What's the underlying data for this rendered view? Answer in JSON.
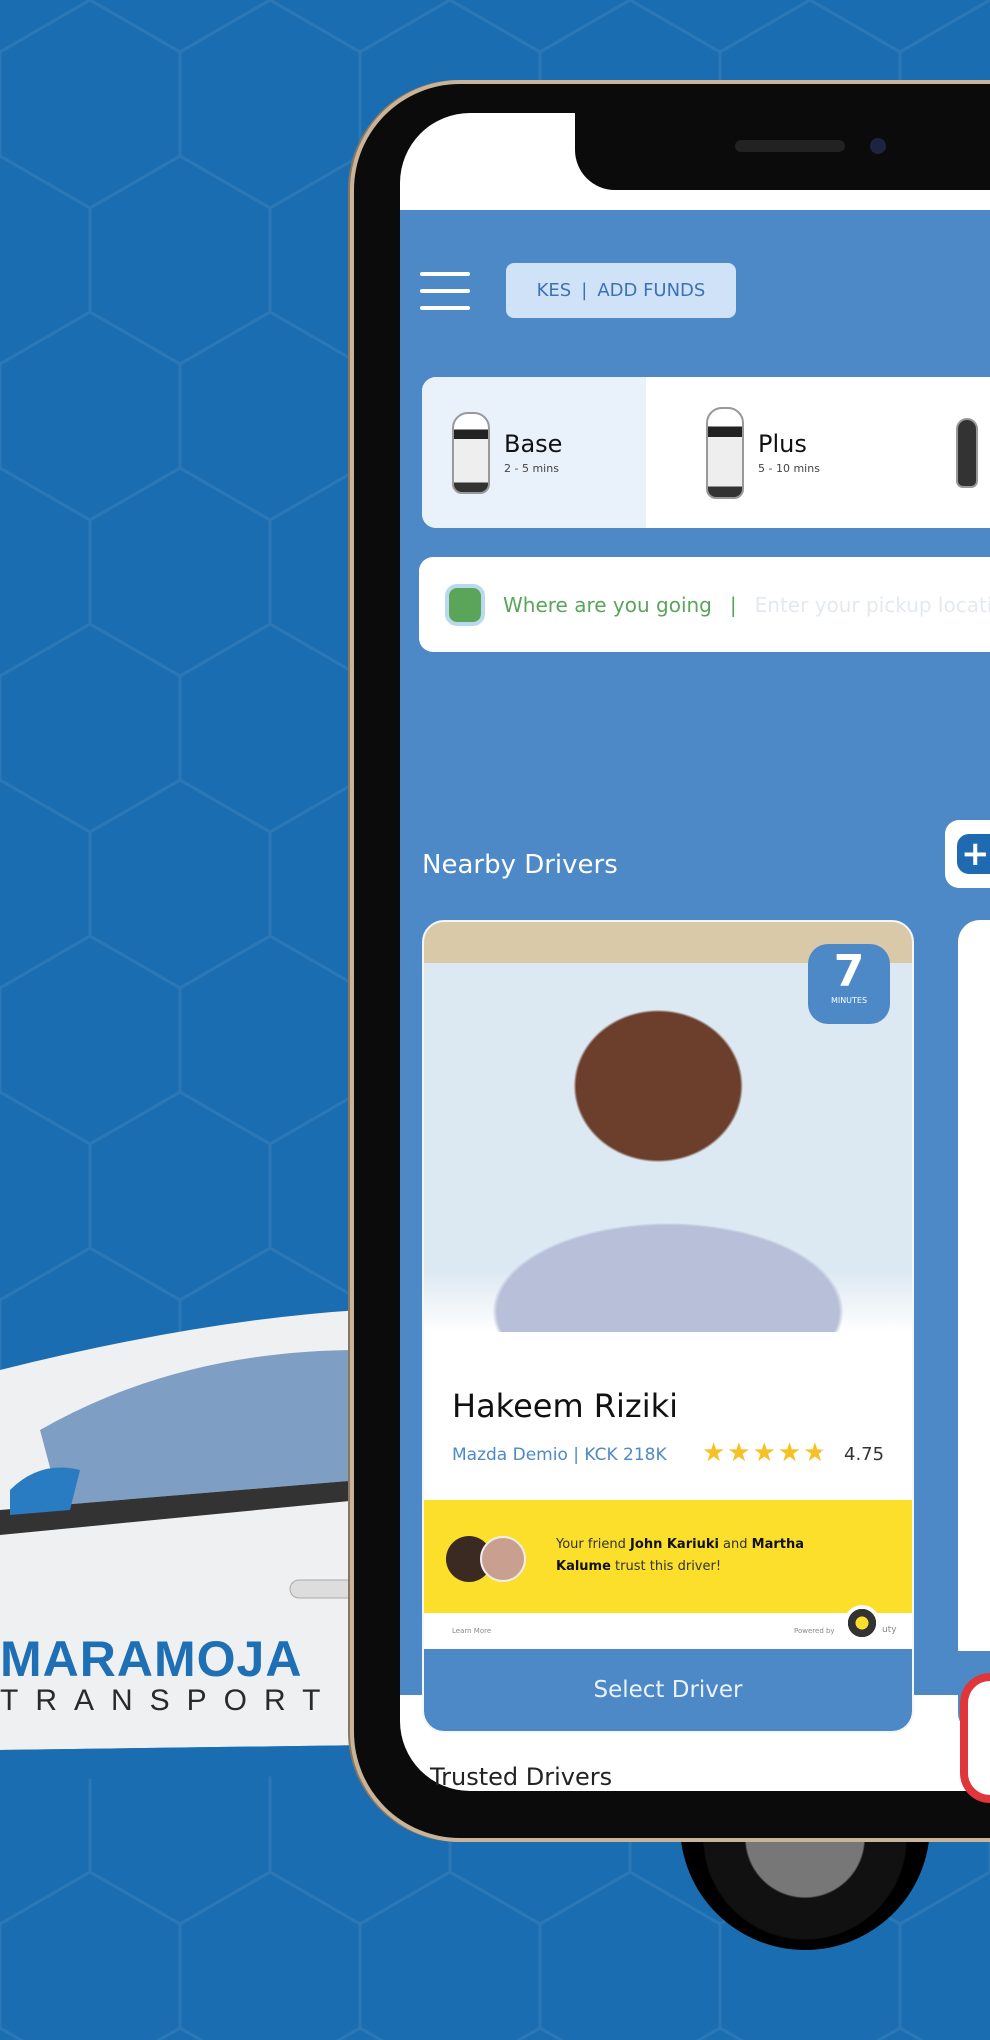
{
  "brand": {
    "name": "MARAMOJA",
    "tagline": "TRANSPORT"
  },
  "header": {
    "currency": "KES",
    "add_funds": "ADD FUNDS",
    "menu_icon": "hamburger-icon"
  },
  "vehicles": [
    {
      "name": "Base",
      "eta": "2 - 5 mins",
      "selected": true
    },
    {
      "name": "Plus",
      "eta": "5 - 10 mins",
      "selected": false
    }
  ],
  "search": {
    "label": "Where are you going",
    "separator": "|",
    "placeholder": "Enter your pickup location"
  },
  "nearby": {
    "title": "Nearby Drivers",
    "add_icon": "plus-icon"
  },
  "driver": {
    "eta_value": "7",
    "eta_unit": "MINUTES",
    "name": "Hakeem Riziki",
    "vehicle": "Mazda Demio | KCK 218K",
    "rating": "4.75",
    "stars": 4.75,
    "trust": {
      "pre": "Your friend ",
      "friend1": "John Kariuki",
      "mid": " and ",
      "friend2": "Martha Kalume",
      "post": " trust this driver!"
    },
    "learn_more": "Learn More",
    "powered_by": "Powered by",
    "powered_brand": "uty",
    "select_label": "Select Driver"
  },
  "trusted": {
    "title": "Trusted Drivers"
  },
  "colors": {
    "background": "#1a6db1",
    "app_blue": "#4d89c7",
    "accent_yellow": "#fbdf2a",
    "star": "#f5c125",
    "green": "#59a55a"
  }
}
